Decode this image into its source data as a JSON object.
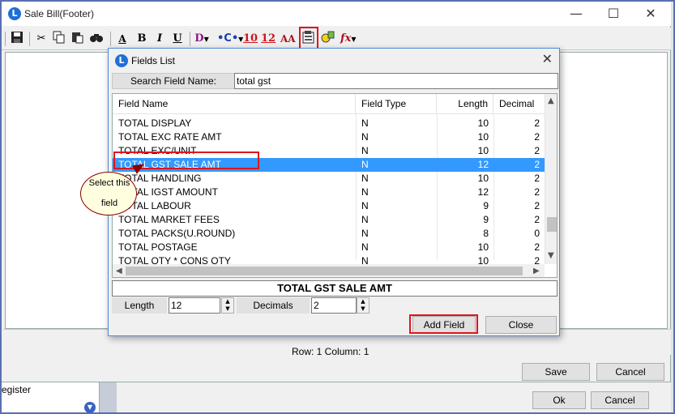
{
  "main": {
    "title": "Sale Bill(Footer)",
    "status_text": "Row: 1  Column: 1",
    "save_label": "Save",
    "cancel_label": "Cancel",
    "ok_label": "Ok",
    "cancel2_label": "Cancel",
    "background_text": "egister",
    "toolbar": {
      "bold": "B",
      "italic": "I",
      "underline": "U",
      "d_menu": "D",
      "font_red1": "10",
      "font_red2": "12",
      "font_aa": "AA",
      "fx": "fx"
    }
  },
  "dialog": {
    "title": "Fields List",
    "search_label": "Search Field Name:",
    "search_value": "total gst",
    "columns": [
      "Field Name",
      "Field Type",
      "Length",
      "Decimal"
    ],
    "rows": [
      {
        "name": "TOTAL DISPLAY",
        "type": "N",
        "length": "10",
        "decimal": "2"
      },
      {
        "name": "TOTAL EXC RATE AMT",
        "type": "N",
        "length": "10",
        "decimal": "2"
      },
      {
        "name": "TOTAL EXC/UNIT",
        "type": "N",
        "length": "10",
        "decimal": "2"
      },
      {
        "name": "TOTAL GST SALE AMT",
        "type": "N",
        "length": "12",
        "decimal": "2"
      },
      {
        "name": "TOTAL HANDLING",
        "type": "N",
        "length": "10",
        "decimal": "2"
      },
      {
        "name": "TOTAL IGST AMOUNT",
        "type": "N",
        "length": "12",
        "decimal": "2"
      },
      {
        "name": "TOTAL LABOUR",
        "type": "N",
        "length": "9",
        "decimal": "2"
      },
      {
        "name": "TOTAL MARKET FEES",
        "type": "N",
        "length": "9",
        "decimal": "2"
      },
      {
        "name": "TOTAL PACKS(U.ROUND)",
        "type": "N",
        "length": "8",
        "decimal": "0"
      },
      {
        "name": "TOTAL POSTAGE",
        "type": "N",
        "length": "10",
        "decimal": "2"
      },
      {
        "name": "TOTAL QTY * CONS QTY",
        "type": "N",
        "length": "10",
        "decimal": "2"
      }
    ],
    "selected_index": 3,
    "selected_field": "TOTAL GST SALE AMT",
    "length_label": "Length",
    "length_value": "12",
    "decimals_label": "Decimals",
    "decimals_value": "2",
    "add_field_label": "Add Field",
    "close_label": "Close"
  },
  "callout": {
    "line1": "Select this",
    "line2": "field"
  },
  "colors": {
    "selection": "#3399ff",
    "highlight": "#e0141e",
    "callout_fill": "#ffffe0"
  }
}
